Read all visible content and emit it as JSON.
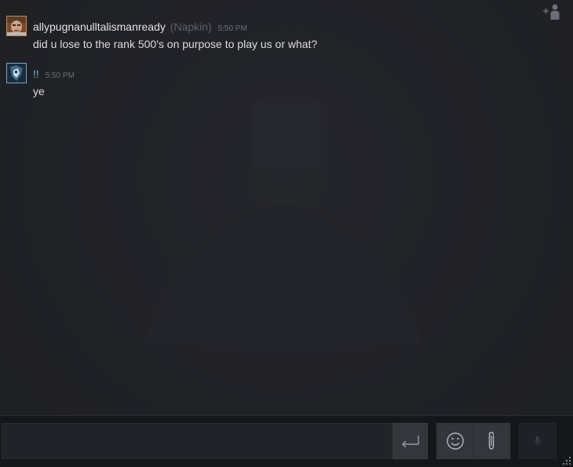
{
  "messages": [
    {
      "sender": "allypugnanulltalismanready",
      "nickname": "(Napkin)",
      "time": "5:50 PM",
      "text": "did u lose to the rank 500's on purpose to play us or what?",
      "status": "ingame"
    },
    {
      "sender": "!!",
      "nickname": "",
      "time": "5:50 PM",
      "text": "ye",
      "status": "online"
    }
  ],
  "input": {
    "value": "",
    "placeholder": ""
  },
  "icons": {
    "add_friend": "add-friend-icon",
    "send": "enter-arrow-icon",
    "emoji": "smiley-icon",
    "attach": "paperclip-icon",
    "voice": "microphone-icon",
    "resize": "resize-grip-icon"
  },
  "colors": {
    "background": "#222328",
    "text": "#dcdde0",
    "online_name": "#6fb5e0",
    "ingame_border": "#c9894f",
    "online_border": "#6fa9c4",
    "input_bar": "#16171a"
  }
}
